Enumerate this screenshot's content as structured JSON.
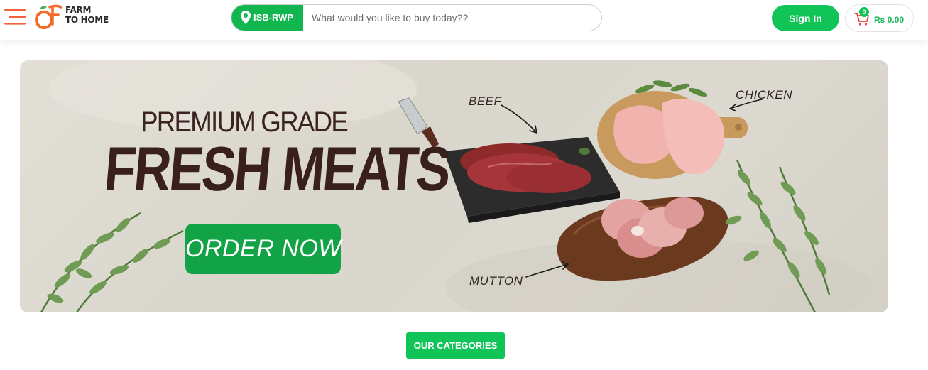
{
  "header": {
    "logo": {
      "line1": "FARM",
      "line2": "TO HOME"
    },
    "location": {
      "label": "ISB-RWP"
    },
    "search": {
      "placeholder": "What would you like to buy today??"
    },
    "signin_label": "Sign In",
    "cart": {
      "count": "0",
      "total": "Rs 0.00"
    }
  },
  "banner": {
    "subtitle": "PREMIUM GRADE",
    "title": "FRESH MEATS",
    "cta_label": "ORDER NOW",
    "labels": {
      "beef": "BEEF",
      "chicken": "CHICKEN",
      "mutton": "MUTTON"
    }
  },
  "categories": {
    "button_label": "OUR CATEGORIES"
  },
  "colors": {
    "brand_green": "#11c458",
    "logo_orange": "#f26b2a",
    "title_brown": "#3a201d"
  },
  "icons": [
    "menu-icon",
    "logo-icon",
    "location-pin-icon",
    "cart-icon"
  ]
}
